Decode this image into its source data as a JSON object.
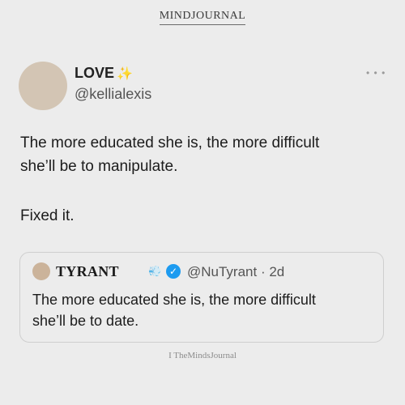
{
  "brand": {
    "logo_text": "MINDJOURNAL"
  },
  "tweet": {
    "display_name": "LOVE",
    "name_emoji": "sparkles-icon",
    "handle": "@kellialexis",
    "menu_icon": "more-options-icon",
    "text_lines": [
      "The more educated she is, the more difficult",
      "she’ll be to manipulate."
    ],
    "reply_line": "Fixed it."
  },
  "quote": {
    "display_name": "TYRANT",
    "name_emoji": "dash-icon",
    "verified_icon": "verified-badge-icon",
    "handle_meta": "@NuTyrant · 2d",
    "text_lines": [
      "The more educated she is, the more difficult",
      "she’ll be to date."
    ]
  },
  "watermark": {
    "text": "I TheMindsJournal"
  },
  "colors": {
    "background": "#ececec",
    "avatar": "#d3c5b4",
    "verified": "#1d9bf0",
    "sparkle": "#e6c24a"
  }
}
